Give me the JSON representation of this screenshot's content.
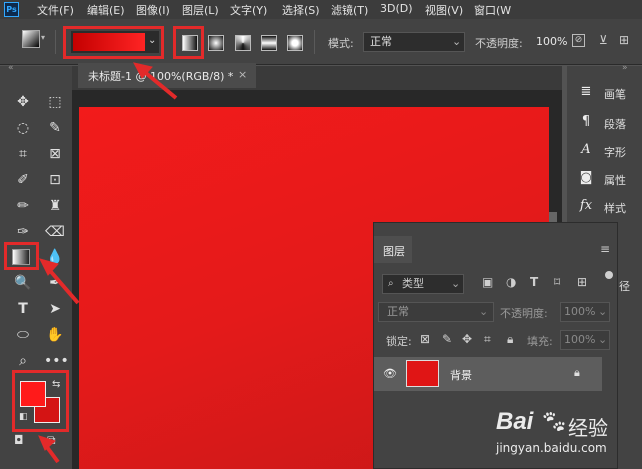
{
  "app": {
    "logo": "Ps"
  },
  "menubar": {
    "items": [
      "文件(F)",
      "编辑(E)",
      "图像(I)",
      "图层(L)",
      "文字(Y)",
      "选择(S)",
      "滤镜(T)",
      "3D(D)",
      "视图(V)",
      "窗口(W"
    ]
  },
  "options": {
    "mode_label": "模式:",
    "mode_value": "正常",
    "opacity_label": "不透明度:",
    "opacity_value": "100%",
    "gradient_colors": [
      "#c40000",
      "#ff2424"
    ]
  },
  "document": {
    "tab_label": "未标题-1 @ 100%(RGB/8) *",
    "close": "×",
    "fill_color": "#e41a1a"
  },
  "toolbar": {
    "foreground_color": "#ff1a1a",
    "background_color": "#d41414",
    "tools": [
      "move-tool",
      "marquee-tool",
      "lasso-tool",
      "quick-select-tool",
      "crop-tool",
      "frame-tool",
      "eyedropper-tool",
      "spot-heal-tool",
      "brush-tool",
      "stamp-tool",
      "history-brush-tool",
      "eraser-tool",
      "gradient-tool",
      "blur-tool",
      "dodge-tool",
      "pen-tool",
      "type-tool",
      "path-select-tool",
      "ellipse-tool",
      "hand-tool",
      "zoom-tool",
      "more-tools"
    ]
  },
  "right_panel": {
    "items": [
      {
        "label": "画笔",
        "icon": "brush-settings-icon"
      },
      {
        "label": "段落",
        "icon": "paragraph-icon"
      },
      {
        "label": "字形",
        "icon": "glyphs-icon"
      },
      {
        "label": "属性",
        "icon": "properties-icon"
      },
      {
        "label": "样式",
        "icon": "styles-icon"
      }
    ]
  },
  "layers_panel": {
    "title": "图层",
    "kind_label": "类型",
    "blend_mode": "正常",
    "opacity_label": "不透明度:",
    "opacity_value": "100%",
    "lock_label": "锁定:",
    "fill_label": "填充:",
    "fill_value": "100%",
    "layers": [
      {
        "name": "背景",
        "locked": true,
        "color": "#e01515"
      }
    ],
    "side_partial": "径"
  },
  "watermark": {
    "brand": "Bai",
    "brand2": "经验",
    "url": "jingyan.baidu.com"
  },
  "accent_color": "#e32a2a"
}
